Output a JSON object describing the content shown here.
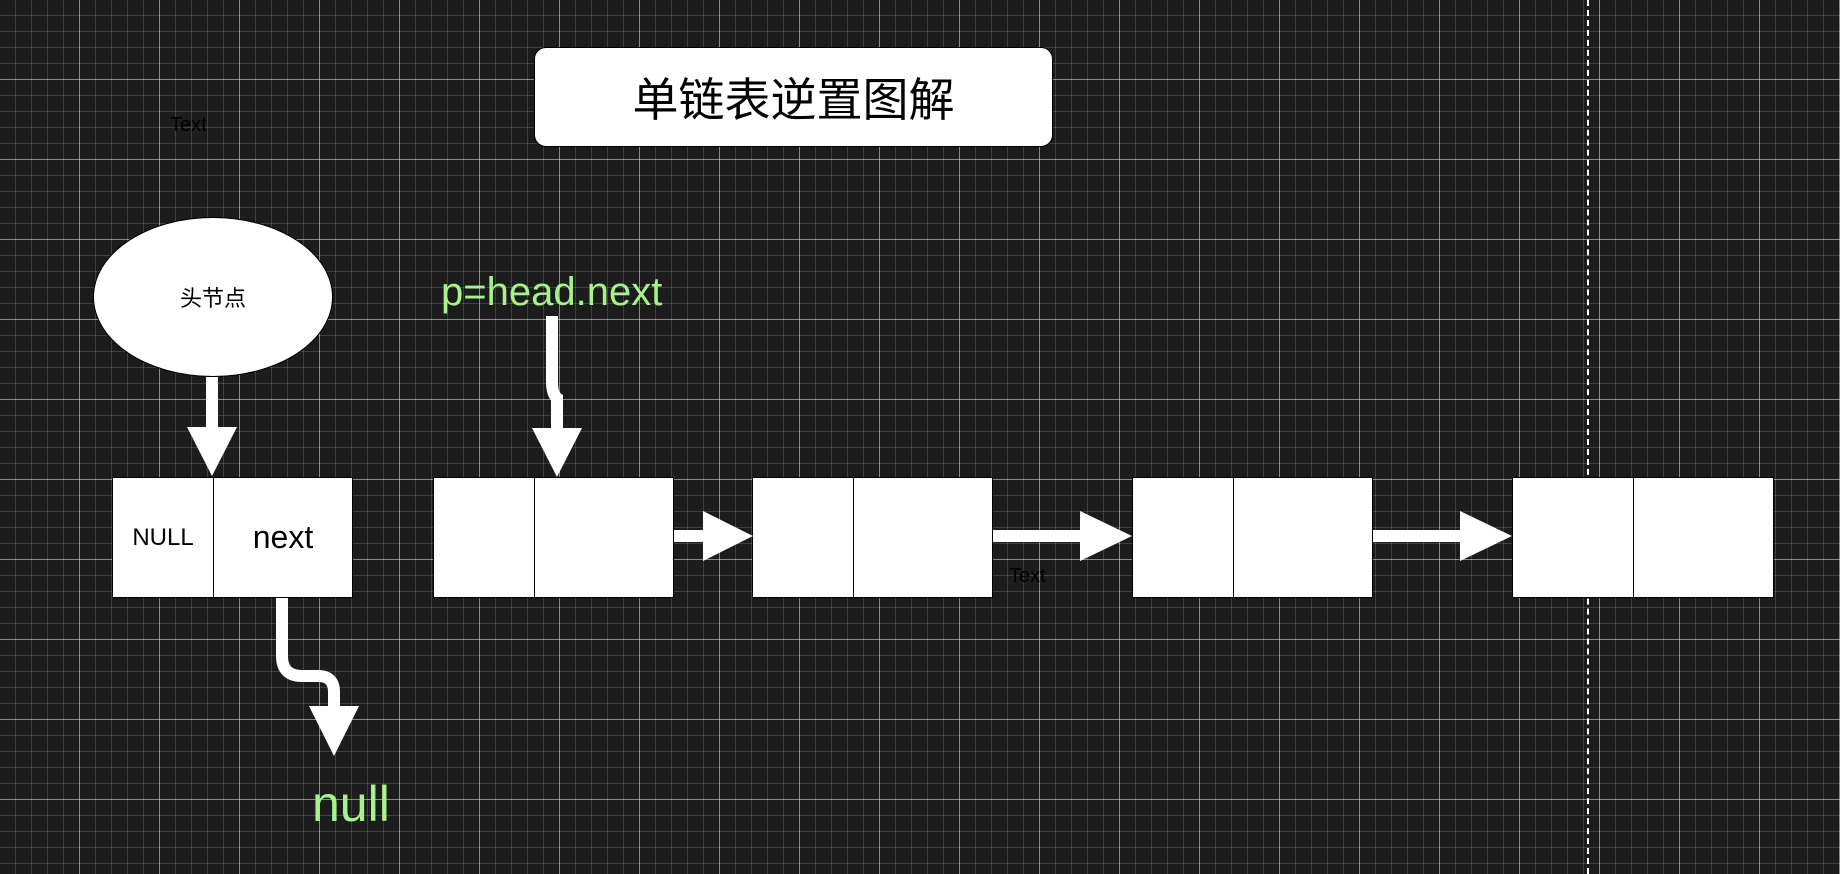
{
  "title": "单链表逆置图解",
  "stray_labels": [
    "Text",
    "Text"
  ],
  "head_node_label": "头节点",
  "pointer_label": "p=head.next",
  "null_label": "null",
  "head_cell": {
    "data": "NULL",
    "next": "next"
  },
  "colors": {
    "background": "#1c1c1c",
    "grid": "#ffffff",
    "accent_green": "#a6f28c",
    "shape_fill": "#ffffff"
  },
  "list_nodes": [
    {
      "data": "",
      "next": ""
    },
    {
      "data": "",
      "next": ""
    },
    {
      "data": "",
      "next": ""
    },
    {
      "data": "",
      "next": ""
    }
  ]
}
